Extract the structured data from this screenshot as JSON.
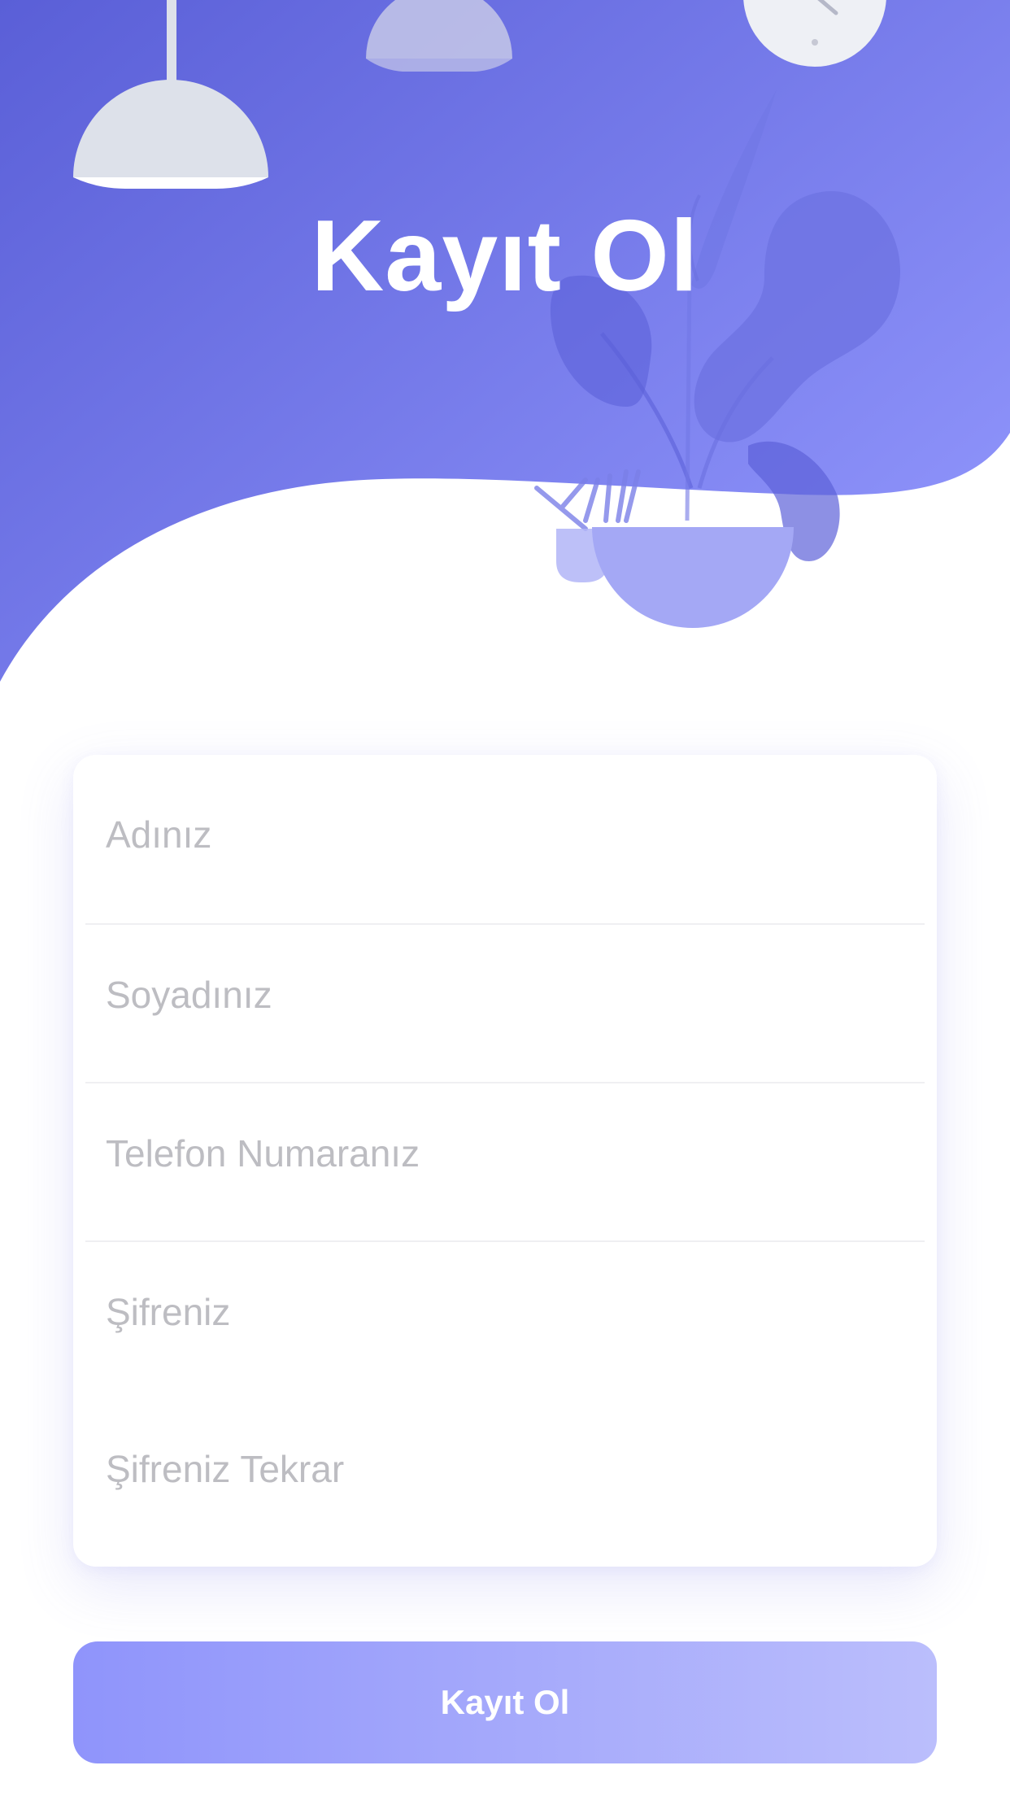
{
  "header": {
    "title": "Kayıt Ol"
  },
  "form": {
    "fields": [
      {
        "placeholder": "Adınız",
        "value": ""
      },
      {
        "placeholder": "Soyadınız",
        "value": ""
      },
      {
        "placeholder": "Telefon Numaranız",
        "value": ""
      },
      {
        "placeholder": "Şifreniz",
        "value": ""
      },
      {
        "placeholder": "Şifreniz Tekrar",
        "value": ""
      }
    ]
  },
  "submit": {
    "label": "Kayıt Ol"
  },
  "colors": {
    "header_gradient_start": "#5a5fd7",
    "header_gradient_end": "#8f94fb",
    "button_gradient_start": "#8f94fb",
    "button_gradient_end": "#bbbefc",
    "placeholder": "#bdbdc2"
  }
}
